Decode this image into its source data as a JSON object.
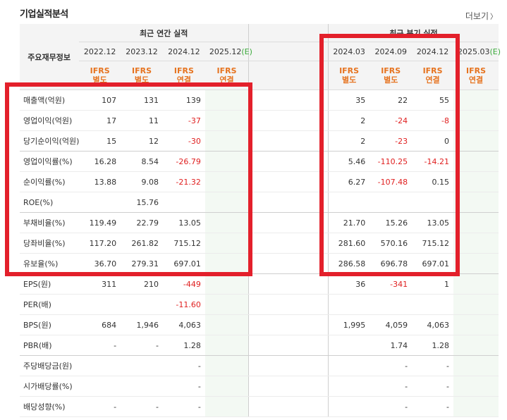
{
  "section_title": "기업실적분석",
  "more_label": "더보기",
  "more_icon": "chevron-right-icon",
  "header": {
    "label_col": "주요재무정보",
    "annual_title": "최근 연간 실적",
    "quarterly_title": "최근 분기 실적",
    "annual_periods": [
      "2022.12",
      "2023.12",
      "2024.12",
      "2025.12"
    ],
    "annual_est_mark": "(E)",
    "quarterly_periods": [
      "2024.03",
      "2024.09",
      "2024.12",
      "2025.03"
    ],
    "quarterly_est_mark": "(E)",
    "annual_ifrs": [
      "IFRS\n별도",
      "IFRS\n별도",
      "IFRS\n연결",
      "IFRS\n연결"
    ],
    "quarterly_ifrs": [
      "IFRS\n별도",
      "IFRS\n별도",
      "IFRS\n연결",
      "IFRS\n연결"
    ]
  },
  "rows": [
    {
      "label": "매출액(억원)",
      "annual": [
        "107",
        "131",
        "139",
        ""
      ],
      "quarterly": [
        "35",
        "22",
        "55",
        ""
      ]
    },
    {
      "label": "영업이익(억원)",
      "annual": [
        "17",
        "11",
        "-37",
        ""
      ],
      "quarterly": [
        "2",
        "-24",
        "-8",
        ""
      ]
    },
    {
      "label": "당기순이익(억원)",
      "annual": [
        "15",
        "12",
        "-30",
        ""
      ],
      "quarterly": [
        "2",
        "-23",
        "0",
        ""
      ]
    },
    {
      "label": "영업이익률(%)",
      "annual": [
        "16.28",
        "8.54",
        "-26.79",
        ""
      ],
      "quarterly": [
        "5.46",
        "-110.25",
        "-14.21",
        ""
      ]
    },
    {
      "label": "순이익률(%)",
      "annual": [
        "13.88",
        "9.08",
        "-21.32",
        ""
      ],
      "quarterly": [
        "6.27",
        "-107.48",
        "0.15",
        ""
      ]
    },
    {
      "label": "ROE(%)",
      "annual": [
        "",
        "15.76",
        "",
        ""
      ],
      "quarterly": [
        "",
        "",
        "",
        ""
      ]
    },
    {
      "label": "부채비율(%)",
      "annual": [
        "119.49",
        "22.79",
        "13.05",
        ""
      ],
      "quarterly": [
        "21.70",
        "15.26",
        "13.05",
        ""
      ]
    },
    {
      "label": "당좌비율(%)",
      "annual": [
        "117.20",
        "261.82",
        "715.12",
        ""
      ],
      "quarterly": [
        "281.60",
        "570.16",
        "715.12",
        ""
      ]
    },
    {
      "label": "유보율(%)",
      "annual": [
        "36.70",
        "279.31",
        "697.01",
        ""
      ],
      "quarterly": [
        "286.58",
        "696.78",
        "697.01",
        ""
      ]
    },
    {
      "label": "EPS(원)",
      "annual": [
        "311",
        "210",
        "-449",
        ""
      ],
      "quarterly": [
        "36",
        "-341",
        "1",
        ""
      ]
    },
    {
      "label": "PER(배)",
      "annual": [
        "",
        "",
        "-11.60",
        ""
      ],
      "quarterly": [
        "",
        "",
        "",
        ""
      ]
    },
    {
      "label": "BPS(원)",
      "annual": [
        "684",
        "1,946",
        "4,063",
        ""
      ],
      "quarterly": [
        "1,995",
        "4,059",
        "4,063",
        ""
      ]
    },
    {
      "label": "PBR(배)",
      "annual": [
        "-",
        "-",
        "1.28",
        ""
      ],
      "quarterly": [
        "",
        "1.74",
        "1.28",
        ""
      ]
    },
    {
      "label": "주당배당금(원)",
      "annual": [
        "",
        "",
        "-",
        ""
      ],
      "quarterly": [
        "",
        "-",
        "-",
        ""
      ]
    },
    {
      "label": "시가배당률(%)",
      "annual": [
        "",
        "",
        "-",
        ""
      ],
      "quarterly": [
        "",
        "-",
        "-",
        ""
      ]
    },
    {
      "label": "배당성향(%)",
      "annual": [
        "-",
        "-",
        "-",
        ""
      ],
      "quarterly": [
        "",
        "-",
        "-",
        ""
      ]
    }
  ],
  "highlight_color": "#e3202b",
  "negative_color": "#e02020"
}
